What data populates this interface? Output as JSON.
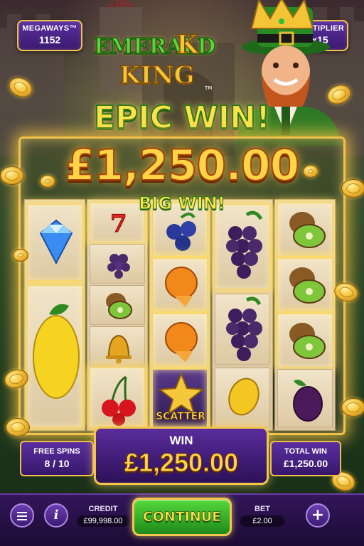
{
  "game": {
    "logo_line1": "EMERALD",
    "logo_k": "K",
    "logo_line2": "KING",
    "logo_tm": "TM"
  },
  "megaways": {
    "label": "MEGAWAYS™",
    "value": "1152"
  },
  "multiplier": {
    "label": "MULTIPLIER",
    "value": "x15"
  },
  "banner": {
    "epic": "EPIC WIN!",
    "amount": "£1,250.00",
    "big": "BIG WIN!"
  },
  "reels": {
    "scatter_label": "SCATTER",
    "columns": [
      [
        "diamond",
        "lemon",
        "lemon"
      ],
      [
        "seven",
        "grapes",
        "kiwi",
        "bell",
        "cherries"
      ],
      [
        "blueberries",
        "orange",
        "orange",
        "star-scatter"
      ],
      [
        "grapes",
        "grapes",
        "lemon-slice"
      ],
      [
        "kiwi",
        "kiwi",
        "kiwi",
        "plum"
      ]
    ]
  },
  "free_spins": {
    "label": "FREE SPINS",
    "value": "8 / 10"
  },
  "win": {
    "label": "WIN",
    "value": "£1,250.00"
  },
  "total_win": {
    "label": "TOTAL WIN",
    "value": "£1,250.00"
  },
  "bar": {
    "credit_label": "CREDIT",
    "credit_value": "£99,998.00",
    "continue_label": "CONTINUE",
    "bet_label": "BET",
    "bet_value": "£2.00",
    "info_glyph": "i",
    "plus_glyph": "+"
  },
  "colors": {
    "gold": "#f4c437",
    "purple": "#5b2fa0",
    "green": "#55d83b",
    "emerald": "#5fd33a"
  }
}
